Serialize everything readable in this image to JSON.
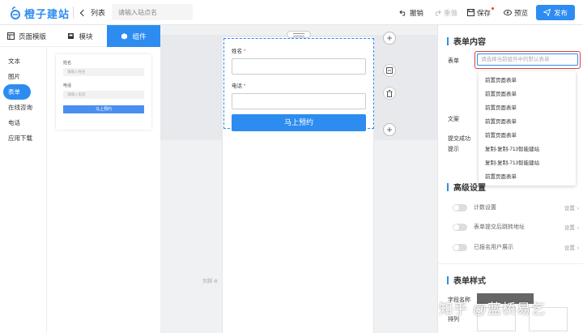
{
  "header": {
    "logo_text": "橙子建站",
    "back_label": "列表",
    "site_input_placeholder": "请输入站点名",
    "undo_label": "撤销",
    "redo_label": "重做",
    "save_label": "保存",
    "preview_label": "预览",
    "publish_label": "发布"
  },
  "left_tabs": [
    {
      "label": "页面模版"
    },
    {
      "label": "模块"
    },
    {
      "label": "组件"
    }
  ],
  "categories": [
    {
      "label": "文本"
    },
    {
      "label": "图片"
    },
    {
      "label": "表单"
    },
    {
      "label": "在线咨询"
    },
    {
      "label": "电话"
    },
    {
      "label": "应用下载"
    }
  ],
  "template_thumb": {
    "name_label": "姓名",
    "name_placeholder": "请输入姓名",
    "phone_label": "电话",
    "phone_placeholder": "请输入电话",
    "button": "马上预约"
  },
  "canvas": {
    "field_name": "姓名",
    "field_phone": "电话",
    "required_mark": "*",
    "submit": "马上预约",
    "footer_hint": "页脚"
  },
  "panel": {
    "form_content_title": "表单内容",
    "form_label": "表单",
    "form_select_placeholder": "请选择当前组件中的默认表单",
    "form_options": [
      "前置页面表单",
      "前置页面表单",
      "前置页面表单",
      "前置页面表单",
      "前置页面表单",
      "复制-复制-713智能建站",
      "复制-复制-713智能建站",
      "前置页面表单"
    ],
    "copy_label": "文案",
    "submit_success_label": "提交成功",
    "submit_hint_label": "提示",
    "advanced_title": "高级设置",
    "toggles": [
      {
        "label": "计数设置",
        "action": "设置"
      },
      {
        "label": "表单提交后跳转地址",
        "action": "设置"
      },
      {
        "label": "已报名用户展示",
        "action": "设置"
      }
    ],
    "form_style_title": "表单样式",
    "field_name_label": "字段名称",
    "layout_label": "排列"
  },
  "watermark": "知乎 @蓝桥易乞",
  "colors": {
    "accent": "#2d8cf0",
    "highlight": "#e53935"
  }
}
